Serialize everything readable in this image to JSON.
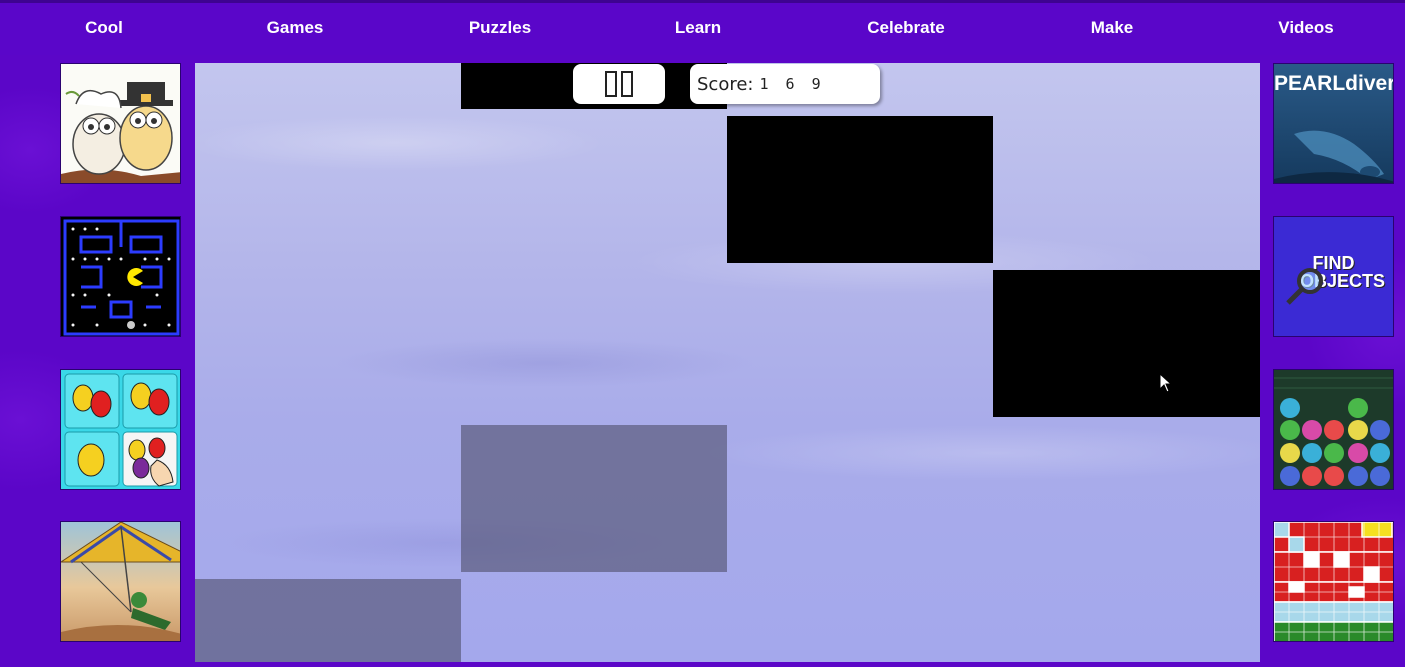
{
  "nav": {
    "items": [
      {
        "label": "Cool"
      },
      {
        "label": "Games"
      },
      {
        "label": "Puzzles"
      },
      {
        "label": "Learn"
      },
      {
        "label": "Celebrate"
      },
      {
        "label": "Make"
      },
      {
        "label": "Videos"
      }
    ]
  },
  "left_thumbs": [
    {
      "icon": "owl-coloring-icon"
    },
    {
      "icon": "pacman-icon"
    },
    {
      "icon": "among-us-match-icon"
    },
    {
      "icon": "hang-glider-icon"
    }
  ],
  "right_thumbs": [
    {
      "icon": "pearl-diver-icon",
      "title": "PEARLdiver"
    },
    {
      "icon": "find-objects-icon",
      "title_line1": "FIND",
      "title_line2": "OBJECTS"
    },
    {
      "icon": "bubble-shooter-icon"
    },
    {
      "icon": "math-grid-icon"
    }
  ],
  "game": {
    "score_label": "Score:",
    "score_value": "1 6 9",
    "pause_icon": "pause-icon"
  },
  "colors": {
    "background": "#5b06c8",
    "nav": "#5a06c9",
    "tile_black": "#000000",
    "tile_gray": "#50506e"
  }
}
